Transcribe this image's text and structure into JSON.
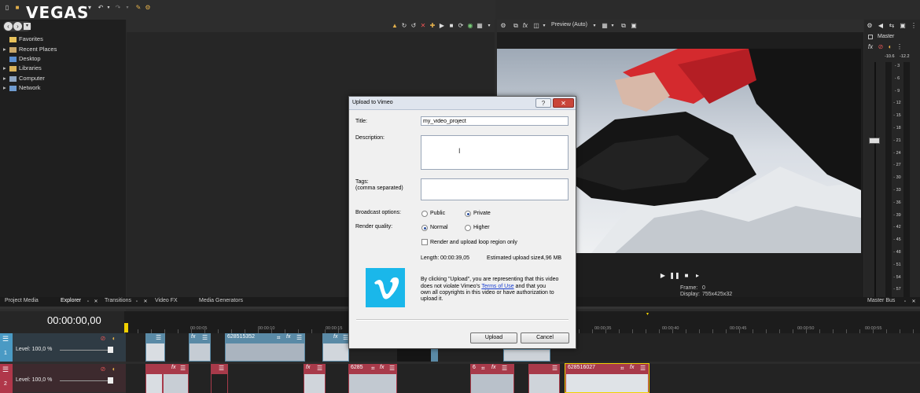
{
  "app": {
    "logo": "VEGAS"
  },
  "explorer": {
    "tree": [
      {
        "label": "Favorites",
        "expandable": false
      },
      {
        "label": "Recent Places",
        "expandable": true
      },
      {
        "label": "Desktop",
        "expandable": false
      },
      {
        "label": "Libraries",
        "expandable": true
      },
      {
        "label": "Computer",
        "expandable": true
      },
      {
        "label": "Network",
        "expandable": true
      }
    ]
  },
  "preview": {
    "mode": "Preview (Auto)",
    "frame_label": "Frame:",
    "frame_value": "0",
    "display_label": "Display:",
    "display_value": "755x425x32"
  },
  "master": {
    "title": "Master",
    "left_peak": "-10.6",
    "right_peak": "-12.2",
    "scale": [
      "3",
      "6",
      "9",
      "12",
      "15",
      "18",
      "21",
      "24",
      "27",
      "30",
      "33",
      "36",
      "39",
      "42",
      "45",
      "48",
      "51",
      "54",
      "57"
    ],
    "bottom_tab": "Master Bus"
  },
  "tabs": [
    "Project Media",
    "Explorer",
    "Transitions",
    "Video FX",
    "Media Generators"
  ],
  "timeline": {
    "timecode": "00:00:00,00",
    "ruler": [
      "00:00:05",
      "00:00:10",
      "00:00:15",
      "00:00:35",
      "00:00:40",
      "00:00:45",
      "00:00:50",
      "00:00:55"
    ],
    "tracks": [
      {
        "num": "1",
        "level": "Level: 100,0 %"
      },
      {
        "num": "2",
        "level": "Level: 100,0 %"
      }
    ],
    "clips": [
      "628515352",
      "6285",
      "6",
      "628516027"
    ]
  },
  "dialog": {
    "title": "Upload to Vimeo",
    "help": "?",
    "close": "✕",
    "title_label": "Title:",
    "title_value": "my_video_project",
    "description_label": "Description:",
    "tags_label": "Tags:",
    "tags_sub": "(comma separated)",
    "broadcast_label": "Broadcast options:",
    "broadcast_public": "Public",
    "broadcast_private": "Private",
    "broadcast_selected": "Private",
    "quality_label": "Render quality:",
    "quality_normal": "Normal",
    "quality_higher": "Higher",
    "quality_selected": "Normal",
    "loop_label": "Render and upload loop region only",
    "length_label": "Length:",
    "length_value": "00:00:39,05",
    "size_label": "Estimated upload size:",
    "size_value": "4,96 MB",
    "legal_1": "By clicking \"Upload\", you are representing that this video",
    "legal_2": "does not violate Vimeo's",
    "legal_link": "Terms of Use",
    "legal_3": "and that you",
    "legal_4": "own all copyrights in this video or have authorization to",
    "legal_5": "upload it.",
    "upload_button": "Upload",
    "cancel_button": "Cancel",
    "brand_color": "#1ab7ea"
  }
}
